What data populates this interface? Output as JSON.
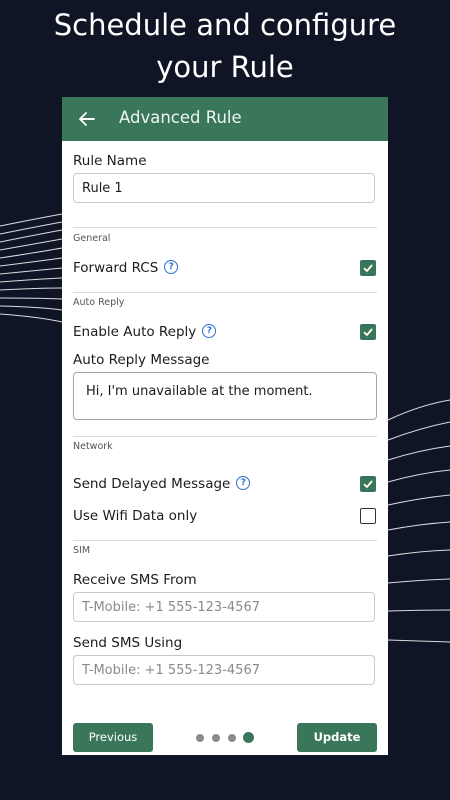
{
  "promo": {
    "line1": "Schedule and configure",
    "line2": "your Rule"
  },
  "appbar": {
    "title": "Advanced Rule",
    "back_icon": "arrow-left-icon"
  },
  "rule_name": {
    "label": "Rule Name",
    "value": "Rule 1"
  },
  "general": {
    "section": "General",
    "forward_rcs": {
      "label": "Forward RCS",
      "checked": true
    }
  },
  "auto_reply": {
    "section": "Auto Reply",
    "enable": {
      "label": "Enable Auto Reply",
      "checked": true
    },
    "message_label": "Auto Reply Message",
    "message_value": "Hi, I'm unavailable at the moment."
  },
  "network": {
    "section": "Network",
    "send_delayed": {
      "label": "Send Delayed Message",
      "checked": true
    },
    "wifi_only": {
      "label": "Use Wifi Data only",
      "checked": false
    }
  },
  "sim": {
    "section": "SIM",
    "receive_label": "Receive SMS From",
    "receive_placeholder": "T-Mobile: +1 555-123-4567",
    "send_label": "Send SMS Using",
    "send_placeholder": "T-Mobile: +1 555-123-4567"
  },
  "footer": {
    "previous_label": "Previous",
    "update_label": "Update",
    "page_count": 4,
    "current_page": 4
  },
  "colors": {
    "accent": "#3a775a",
    "background": "#0f1524",
    "help_icon": "#2d6fd1"
  }
}
